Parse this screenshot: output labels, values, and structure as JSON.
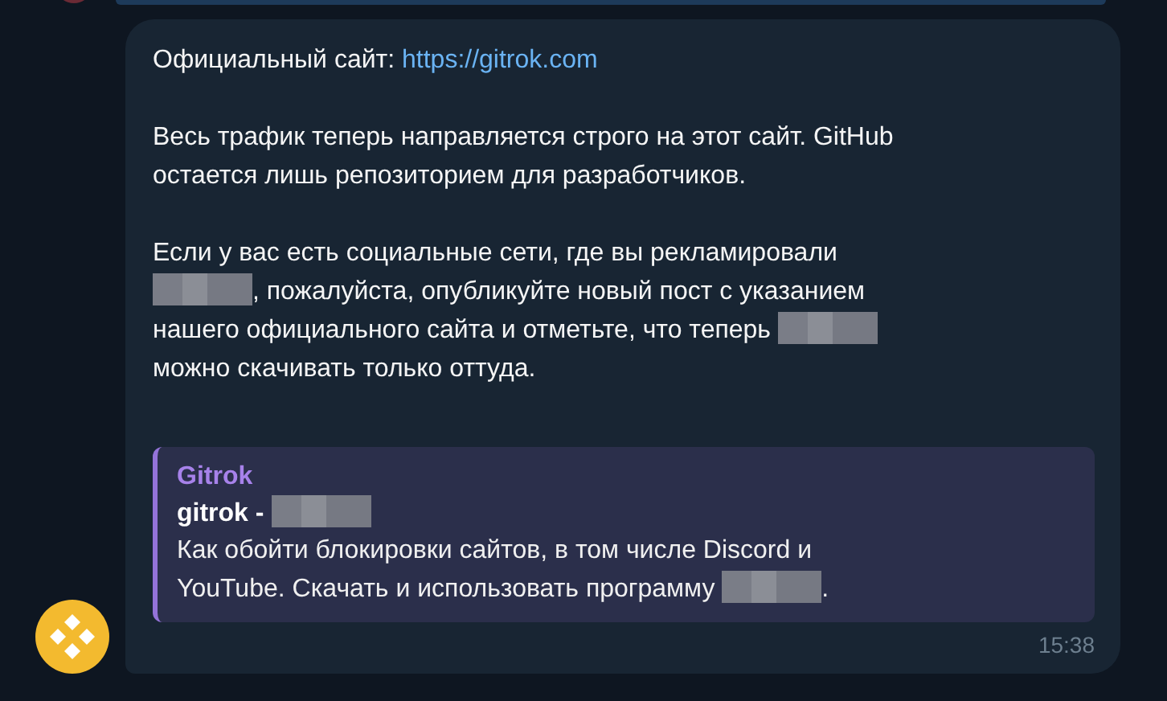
{
  "message": {
    "paragraphs": [
      {
        "lines": [
          [
            {
              "kind": "text",
              "text": "Официальный сайт: "
            },
            {
              "kind": "link",
              "text": "https://gitrok.com"
            }
          ]
        ]
      },
      {
        "lines": [
          [
            {
              "kind": "text",
              "text": "Весь трафик теперь направляется строго на этот сайт. GitHub"
            }
          ],
          [
            {
              "kind": "text",
              "text": "остается лишь репозиторием для разработчиков."
            }
          ]
        ]
      },
      {
        "lines": [
          [
            {
              "kind": "text",
              "text": "Если у вас есть социальные сети, где вы рекламировали"
            }
          ],
          [
            {
              "kind": "redacted"
            },
            {
              "kind": "text",
              "text": ", пожалуйста, опубликуйте новый пост с указанием"
            }
          ],
          [
            {
              "kind": "text",
              "text": "нашего официального сайта и отметьте, что теперь "
            },
            {
              "kind": "redacted"
            }
          ],
          [
            {
              "kind": "text",
              "text": "можно скачивать только оттуда."
            }
          ]
        ]
      }
    ],
    "preview": {
      "site_name": "Gitrok",
      "title": [
        {
          "kind": "text",
          "text": "gitrok - "
        },
        {
          "kind": "redacted"
        }
      ],
      "description": [
        [
          {
            "kind": "text",
            "text": "Как обойти блокировки сайтов, в том числе Discord и"
          }
        ],
        [
          {
            "kind": "text",
            "text": "YouTube. Скачать и использовать программу "
          },
          {
            "kind": "redacted"
          },
          {
            "kind": "text",
            "text": "."
          }
        ]
      ]
    },
    "time": "15:38"
  }
}
